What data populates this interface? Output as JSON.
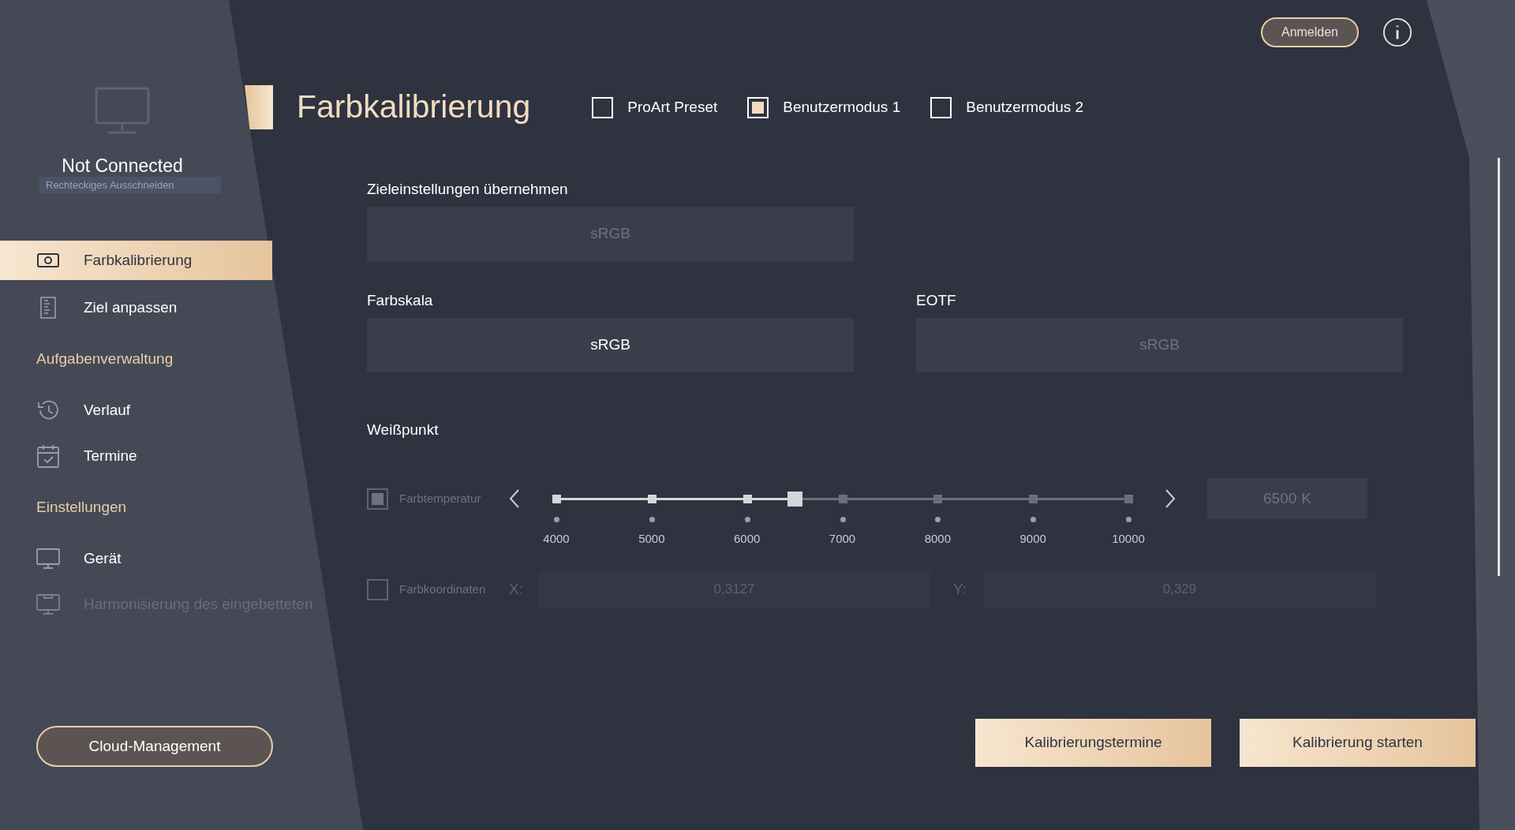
{
  "sidebar": {
    "device_status": "Not Connected",
    "tooltip": "Rechteckiges Ausschneiden",
    "items": [
      {
        "kind": "item",
        "label": "Farbkalibrierung",
        "selected": true,
        "disabled": false
      },
      {
        "kind": "item",
        "label": "Ziel anpassen",
        "selected": false,
        "disabled": false
      },
      {
        "kind": "header",
        "label": "Aufgabenverwaltung"
      },
      {
        "kind": "item",
        "label": "Verlauf",
        "selected": false,
        "disabled": false
      },
      {
        "kind": "item",
        "label": "Termine",
        "selected": false,
        "disabled": false
      },
      {
        "kind": "header",
        "label": "Einstellungen"
      },
      {
        "kind": "item",
        "label": "Gerät",
        "selected": false,
        "disabled": false
      },
      {
        "kind": "item",
        "label": "Harmonisierung des eingebetteten",
        "selected": false,
        "disabled": true
      }
    ],
    "cloud_button": "Cloud-Management"
  },
  "header": {
    "title": "Farbkalibrierung",
    "login_button": "Anmelden",
    "modes": [
      {
        "label": "ProArt Preset",
        "checked": false
      },
      {
        "label": "Benutzermodus 1",
        "checked": true
      },
      {
        "label": "Benutzermodus 2",
        "checked": false
      }
    ]
  },
  "target": {
    "label": "Zieleinstellungen übernehmen",
    "value": "sRGB",
    "disabled": true
  },
  "gamut": {
    "label": "Farbskala",
    "value": "sRGB",
    "disabled": false
  },
  "eotf": {
    "label": "EOTF",
    "value": "sRGB",
    "disabled": true
  },
  "white_point": {
    "label": "Weißpunkt",
    "temperature": {
      "label": "Farbtemperatur",
      "checked": true,
      "level": 0.4167,
      "ticks": [
        "4000",
        "5000",
        "6000",
        "7000",
        "8000",
        "9000",
        "10000"
      ],
      "value": "6500",
      "unit": "K"
    },
    "coordinates": {
      "label": "Farbkoordinaten",
      "checked": false,
      "x_label": "X:",
      "x_value": "0,3127",
      "y_label": "Y:",
      "y_value": "0,329"
    }
  },
  "buttons": [
    "Kalibrierungstermine",
    "Kalibrierung starten"
  ]
}
